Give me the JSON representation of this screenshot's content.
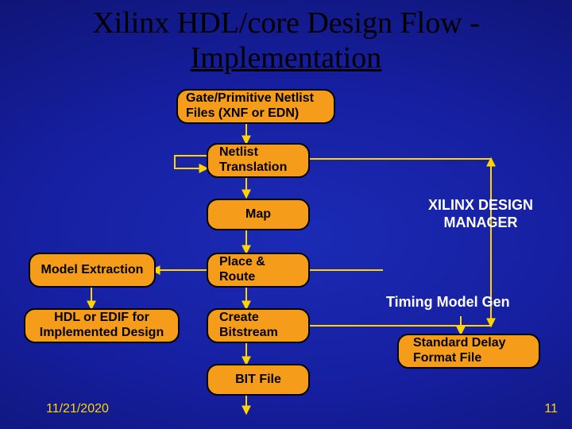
{
  "title": {
    "line1": "Xilinx HDL/core Design Flow -",
    "line2": "Implementation"
  },
  "boxes": {
    "gate": "Gate/Primitive Netlist\nFiles (XNF or EDN)",
    "netlist": "Netlist\nTranslation",
    "map": "Map",
    "place": "Place &\nRoute",
    "model": "Model Extraction",
    "hdl": "HDL or EDIF for\nImplemented Design",
    "create": "Create\nBitstream",
    "bit": "BIT File",
    "sdf": "Standard Delay\nFormat File"
  },
  "labels": {
    "manager": "XILINX DESIGN\nMANAGER",
    "timing": "Timing Model Gen"
  },
  "footer": {
    "date": "11/21/2020",
    "page": "11"
  }
}
